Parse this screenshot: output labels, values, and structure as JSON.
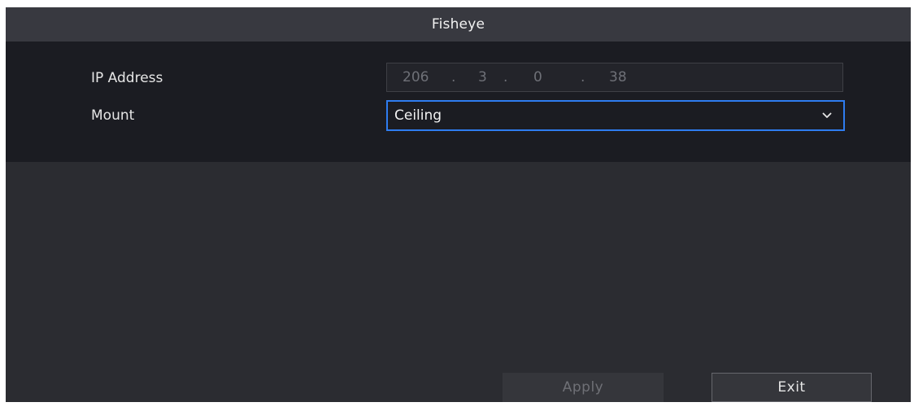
{
  "dialog": {
    "title": "Fisheye"
  },
  "form": {
    "ip_address": {
      "label": "IP Address",
      "octets": [
        "206",
        "3",
        "0",
        "38"
      ],
      "separator": "."
    },
    "mount": {
      "label": "Mount",
      "value": "Ceiling",
      "dropdown_icon": "chevron-down-icon"
    }
  },
  "buttons": {
    "apply_label": "Apply",
    "exit_label": "Exit"
  },
  "colors": {
    "accent": "#2e7cf0",
    "panel_bg": "#1b1c22",
    "dialog_bg": "#2b2c31",
    "titlebar_bg": "#383940"
  }
}
